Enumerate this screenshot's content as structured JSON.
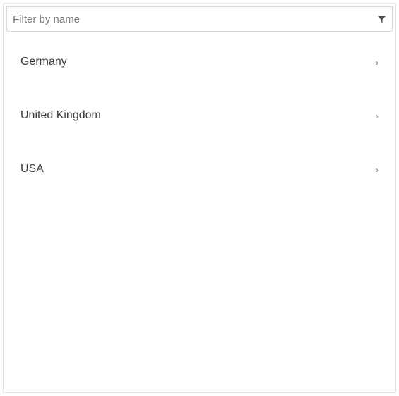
{
  "filter": {
    "placeholder": "Filter by name",
    "value": ""
  },
  "list": {
    "items": [
      {
        "label": "Germany"
      },
      {
        "label": "United Kingdom"
      },
      {
        "label": "USA"
      }
    ]
  }
}
